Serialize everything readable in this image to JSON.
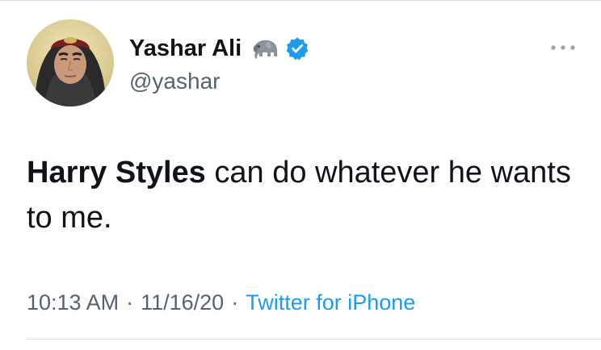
{
  "tweet": {
    "author": {
      "display_name": "Yashar Ali",
      "handle": "@yashar",
      "emoji": "elephant-emoji",
      "verified_badge": "verified-badge-icon"
    },
    "more_icon": "more-horizontal-icon",
    "text": {
      "bold_part": "Harry Styles",
      "rest": " can do whatever he wants to me."
    },
    "meta": {
      "time": "10:13 AM",
      "separator": "·",
      "date": "11/16/20",
      "source": "Twitter for iPhone"
    }
  },
  "colors": {
    "text_primary": "#0f1419",
    "text_secondary": "#536471",
    "accent": "#1d9bf0",
    "divider": "#d9dee2"
  }
}
